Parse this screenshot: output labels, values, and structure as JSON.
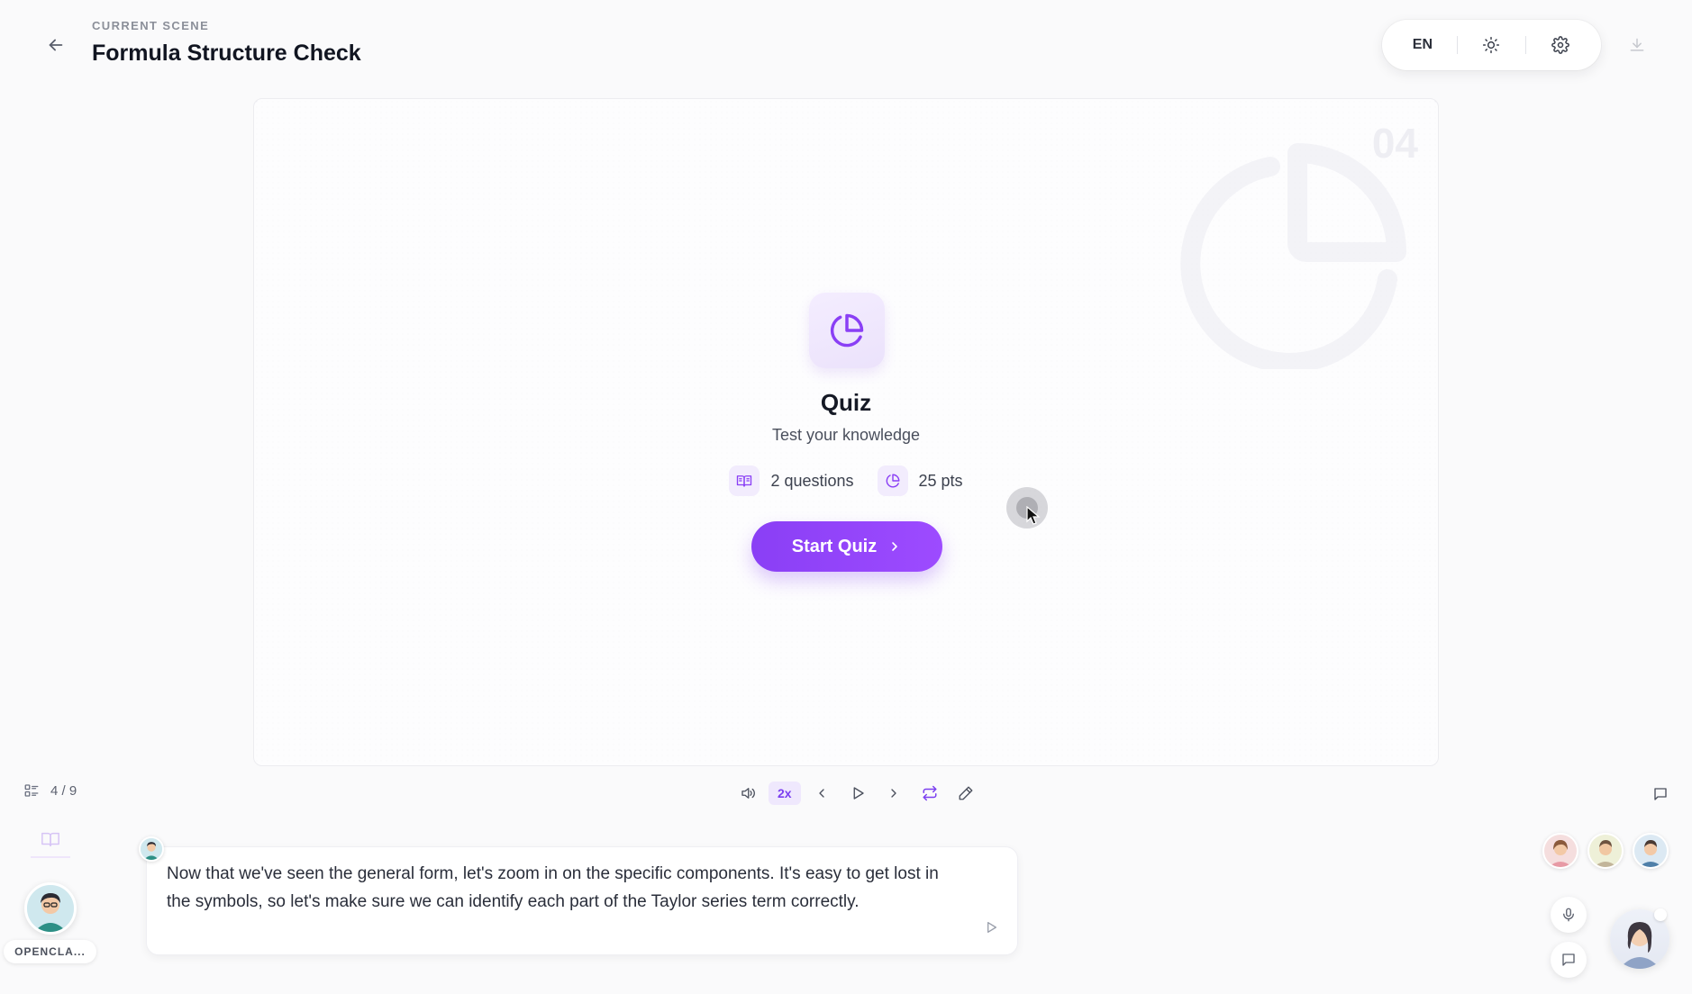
{
  "header": {
    "kicker": "CURRENT SCENE",
    "title": "Formula Structure Check",
    "language": "EN",
    "icons": [
      "back-arrow-icon",
      "sun-icon",
      "gear-icon",
      "download-icon"
    ]
  },
  "slide": {
    "number": "04",
    "icon": "pie-chart-icon",
    "title": "Quiz",
    "subtitle": "Test your knowledge",
    "meta": {
      "questions": "2 questions",
      "points": "25 pts"
    },
    "start_label": "Start Quiz",
    "accent": "#8a3ff5"
  },
  "playbar": {
    "scene_counter": "4 / 9",
    "speed": "2x",
    "icons": [
      "list-icon",
      "volume-icon",
      "prev-icon",
      "play-icon",
      "next-icon",
      "repeat-icon",
      "pen-icon",
      "chat-icon"
    ]
  },
  "agent": {
    "label": "OPENCLA..."
  },
  "speech": {
    "text": "Now that we've seen the general form, let's zoom in on the specific components. It's easy to get lost in the symbols, so let's make sure we can identify each part of the Taylor series term correctly."
  }
}
